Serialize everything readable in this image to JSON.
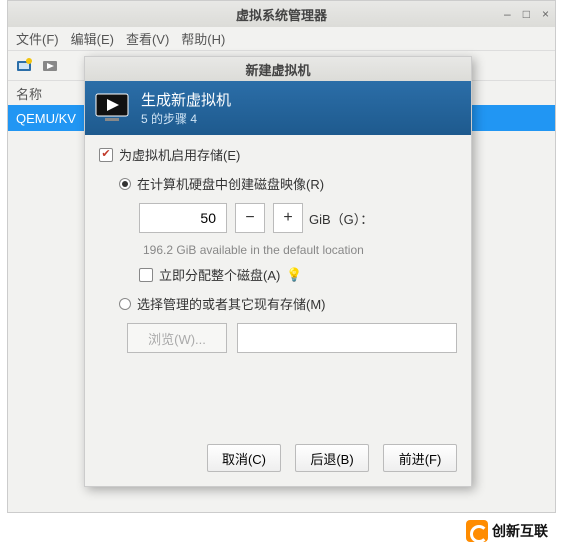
{
  "main_window": {
    "title": "虚拟系统管理器",
    "minimize": "–",
    "maximize": "□",
    "close": "×",
    "menu": {
      "file": "文件(F)",
      "edit": "编辑(E)",
      "view": "查看(V)",
      "help": "帮助(H)"
    },
    "list_header": "名称",
    "list_row": "QEMU/KV"
  },
  "dialog": {
    "title": "新建虚拟机",
    "banner_title": "生成新虚拟机",
    "banner_step": "5 的步骤 4",
    "enable_storage": "为虚拟机启用存储(E)",
    "create_disk": "在计算机硬盘中创建磁盘映像(R)",
    "size_value": "50",
    "size_minus": "−",
    "size_plus": "+",
    "size_unit": "GiB（G）：",
    "available_hint": "196.2 GiB available in the default location",
    "allocate_now": "立即分配整个磁盘(A)",
    "bulb": "💡",
    "select_existing": "选择管理的或者其它现有存储(M)",
    "browse": "浏览(W)...",
    "btn_cancel": "取消(C)",
    "btn_back": "后退(B)",
    "btn_forward": "前进(F)"
  },
  "watermark": {
    "text": "创新互联"
  }
}
